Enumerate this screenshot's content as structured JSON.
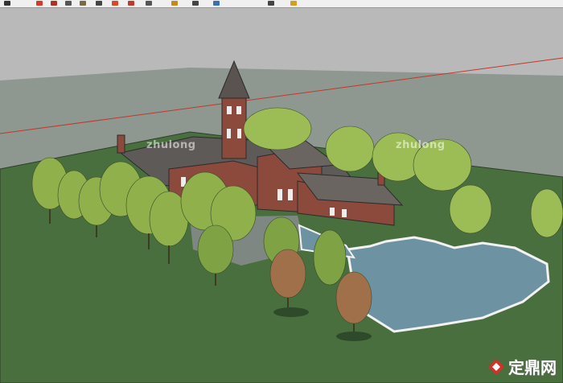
{
  "toolbar": {
    "tools": [
      {
        "icon": "select-arrow-icon",
        "color": "#333333"
      },
      {
        "icon": "eraser-icon",
        "color": "#d23a2a"
      },
      {
        "icon": "pencil-icon",
        "color": "#b33020"
      },
      {
        "icon": "line-icon",
        "color": "#555555"
      },
      {
        "icon": "rectangle-icon",
        "color": "#7a6a4a"
      },
      {
        "icon": "arc-icon",
        "color": "#444444"
      },
      {
        "icon": "push-pull-icon",
        "color": "#d44a2a"
      },
      {
        "icon": "move-icon",
        "color": "#c0392b"
      },
      {
        "icon": "rotate-icon",
        "color": "#555555"
      },
      {
        "icon": "paint-bucket-icon",
        "color": "#c08a20"
      },
      {
        "icon": "tape-measure-icon",
        "color": "#444444"
      },
      {
        "icon": "orbit-icon",
        "color": "#3a6fb0"
      },
      {
        "icon": "zoom-icon",
        "color": "#444444"
      },
      {
        "icon": "zoom-extents-icon",
        "color": "#d0a020"
      }
    ]
  },
  "watermarks": {
    "left": "zhulong",
    "right": "zhulong"
  },
  "brand": {
    "text": "定鼎网",
    "logo_color": "#d4302a"
  },
  "scene": {
    "sky_color": "#b9b9b9",
    "ground_color": "#8f9791",
    "lawn_color": "#4a6f3e",
    "water_color": "#6d93a3",
    "axis_color": "#c0392b"
  }
}
